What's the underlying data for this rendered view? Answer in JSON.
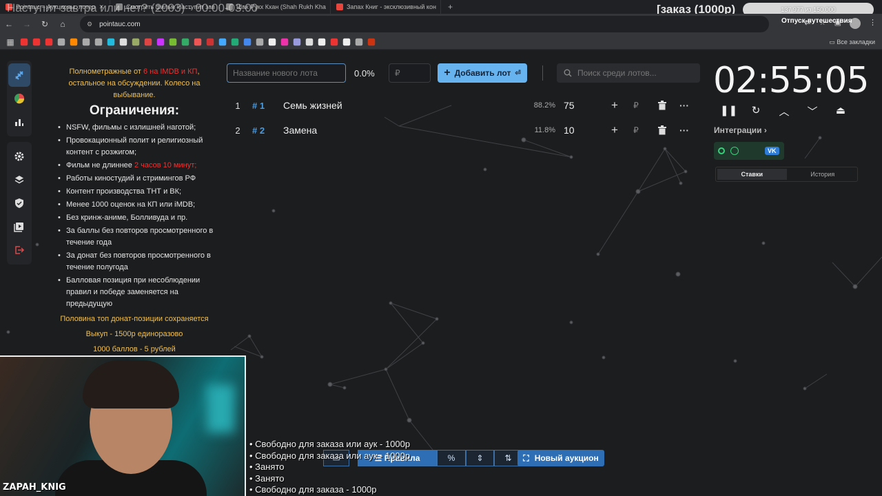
{
  "browser": {
    "tabs": [
      {
        "label": "Pointauc – Аукционы, лотер",
        "color": "#e8453c"
      },
      {
        "label": "Смотреть фильм Наступит зав",
        "color": "#888888"
      },
      {
        "label": "Шах Рукх Кхан (Shah Rukh Kha",
        "color": "#888888"
      },
      {
        "label": "Запах Книг - эксклюзивный кон",
        "color": "#e8453c"
      }
    ],
    "url": "pointauc.com",
    "all_bookmarks": "Все закладки",
    "bookmark_colors": [
      "#e33",
      "#e33",
      "#e33",
      "#aaa",
      "#f80",
      "#aaa",
      "#aaa",
      "#2bd",
      "#ddd",
      "#9a6",
      "#d44",
      "#c3f",
      "#7b3",
      "#3a6",
      "#e55",
      "#c33",
      "#4af",
      "#2a7",
      "#48e",
      "#aaa",
      "#eee",
      "#e3a",
      "#99d",
      "#ddd",
      "#eee",
      "#e33",
      "#eee",
      "#aaa",
      "#c31"
    ]
  },
  "overlay": {
    "title": "Наступит завтра или нет? (2003) - 00:00-03:00",
    "order_price": "[заказ (1000р)",
    "progress": "137 977  из 150 000",
    "vacation": "Отпуск-путешествия"
  },
  "rules": {
    "intro_pre": "Полнометражные от ",
    "intro_red": "6 на IMDB и КП",
    "intro_post": ", остальное на обсуждении. Колесо на выбывание.",
    "heading": "Ограничения:",
    "items": [
      "NSFW, фильмы с излишней наготой;",
      "Провокационный полит и религиозный контент с розжигом;",
      "Работы киностудий и стримингов РФ",
      "Контент производства ТНТ и ВК;",
      "Менее 1000 оценок на КП или iMDB;",
      "Без кринж-аниме, Болливуда и пр.",
      "За баллы без повторов просмотренного в течение года",
      "За донат без повторов просмотренного в течение полугода",
      "Балловая позиция при несоблюдении правил и победе заменяется на предыдущую"
    ],
    "length_pre": "Фильм не длиннее ",
    "length_red": "2 часов 10 минут;",
    "yellow": [
      "Половина топ донат-позиции сохраняется",
      "Выкуп - 1500р единоразово",
      "1000 баллов - 5 рублей"
    ]
  },
  "controls": {
    "lot_placeholder": "Название нового лота",
    "total_percent": "0.0%",
    "amount_placeholder": "₽",
    "add_label": "Добавить лот",
    "search_placeholder": "Поиск среди лотов..."
  },
  "lots": [
    {
      "num": "1",
      "id": "# 1",
      "name": "Семь жизней",
      "pct": "88.2%",
      "amount": "75"
    },
    {
      "num": "2",
      "id": "# 2",
      "name": "Замена",
      "pct": "11.8%",
      "amount": "10"
    }
  ],
  "timer": {
    "value": "02:55:05",
    "integrations": "Интеграции",
    "vk": "VK",
    "tab_bets": "Ставки",
    "tab_history": "История"
  },
  "bottom": {
    "rules_label": "Правила",
    "percent_label": "%",
    "new_auction": "Новый аукцион"
  },
  "order_list": [
    "Свободно для заказа или аук - 1000р",
    "Свободно для заказа или аук - 1000р",
    "Занято",
    "Занято",
    "Свободно для заказа - 1000р"
  ],
  "streamer": "ZAPAH_KNIG",
  "accent": "#66b3f0"
}
